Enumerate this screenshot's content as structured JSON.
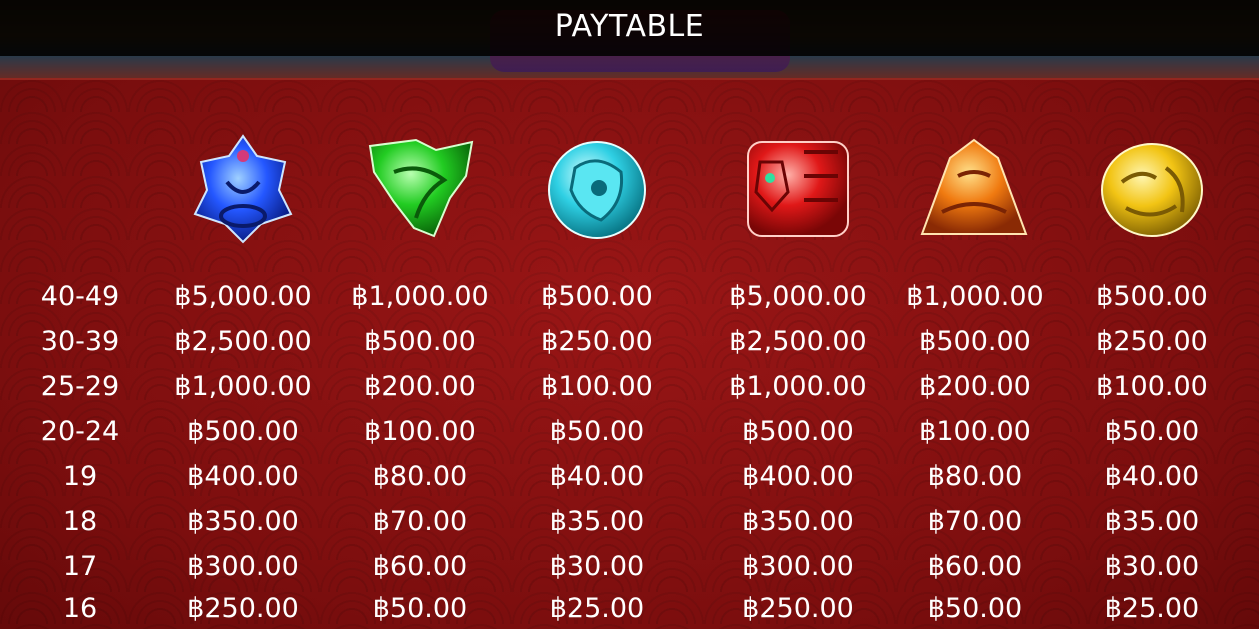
{
  "title": "PAYTABLE",
  "symbols": [
    {
      "icon": "blue-jade-dragon-icon",
      "color": "#1f5bff"
    },
    {
      "icon": "green-jade-dragon-icon",
      "color": "#1fc81f"
    },
    {
      "icon": "cyan-jade-dragon-icon",
      "color": "#2fd6e8"
    },
    {
      "icon": "red-jade-tiger-icon",
      "color": "#e01818"
    },
    {
      "icon": "orange-jade-tiger-icon",
      "color": "#f07a10"
    },
    {
      "icon": "gold-jade-tiger-icon",
      "color": "#f2c414"
    }
  ],
  "rows": [
    {
      "label": "40-49",
      "values": [
        "฿5,000.00",
        "฿1,000.00",
        "฿500.00",
        "฿5,000.00",
        "฿1,000.00",
        "฿500.00"
      ]
    },
    {
      "label": "30-39",
      "values": [
        "฿2,500.00",
        "฿500.00",
        "฿250.00",
        "฿2,500.00",
        "฿500.00",
        "฿250.00"
      ]
    },
    {
      "label": "25-29",
      "values": [
        "฿1,000.00",
        "฿200.00",
        "฿100.00",
        "฿1,000.00",
        "฿200.00",
        "฿100.00"
      ]
    },
    {
      "label": "20-24",
      "values": [
        "฿500.00",
        "฿100.00",
        "฿50.00",
        "฿500.00",
        "฿100.00",
        "฿50.00"
      ]
    },
    {
      "label": "19",
      "values": [
        "฿400.00",
        "฿80.00",
        "฿40.00",
        "฿400.00",
        "฿80.00",
        "฿40.00"
      ]
    },
    {
      "label": "18",
      "values": [
        "฿350.00",
        "฿70.00",
        "฿35.00",
        "฿350.00",
        "฿70.00",
        "฿35.00"
      ]
    },
    {
      "label": "17",
      "values": [
        "฿300.00",
        "฿60.00",
        "฿30.00",
        "฿300.00",
        "฿60.00",
        "฿30.00"
      ]
    },
    {
      "label": "16",
      "values": [
        "฿250.00",
        "฿50.00",
        "฿25.00",
        "฿250.00",
        "฿50.00",
        "฿25.00"
      ]
    }
  ]
}
